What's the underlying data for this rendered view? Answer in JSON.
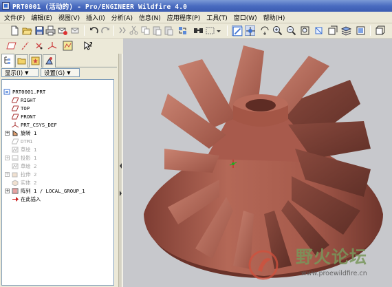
{
  "window": {
    "title": "PRT0001 (活动的) - Pro/ENGINEER Wildfire 4.0"
  },
  "menu": [
    {
      "label": "文件(F)"
    },
    {
      "label": "编辑(E)"
    },
    {
      "label": "视图(V)"
    },
    {
      "label": "插入(I)"
    },
    {
      "label": "分析(A)"
    },
    {
      "label": "信息(N)"
    },
    {
      "label": "应用程序(P)"
    },
    {
      "label": "工具(T)"
    },
    {
      "label": "窗口(W)"
    },
    {
      "label": "帮助(H)"
    }
  ],
  "panel": {
    "show_dropdown": "显示(I)",
    "settings_dropdown": "设置(G)"
  },
  "tree": {
    "items": [
      {
        "label": "PRT0001.PRT",
        "icon": "part-icon"
      },
      {
        "label": "RIGHT",
        "icon": "datum-plane-icon"
      },
      {
        "label": "TOP",
        "icon": "datum-plane-icon"
      },
      {
        "label": "FRONT",
        "icon": "datum-plane-icon"
      },
      {
        "label": "PRT_CSYS_DEF",
        "icon": "csys-icon"
      },
      {
        "label": "旋转 1",
        "icon": "revolve-icon"
      },
      {
        "label": "DTM1",
        "icon": "datum-plane-icon"
      },
      {
        "label": "草绘 1",
        "icon": "sketch-icon"
      },
      {
        "label": "投影 1",
        "icon": "projection-icon"
      },
      {
        "label": "草绘 2",
        "icon": "sketch-icon"
      },
      {
        "label": "拉伸 2",
        "icon": "extrude-icon"
      },
      {
        "label": "实体 2",
        "icon": "solid-icon"
      },
      {
        "label": "阵列 1 / LOCAL_GROUP_1",
        "icon": "pattern-icon"
      },
      {
        "label": "在此插入",
        "icon": "insert-here-icon"
      }
    ]
  },
  "watermark": {
    "text": "野火论坛",
    "url": "www.proewildfire.cn"
  },
  "colors": {
    "titlebar": "#3b5cb2",
    "model": "#a85a4c",
    "background": "#c7c8cc"
  }
}
